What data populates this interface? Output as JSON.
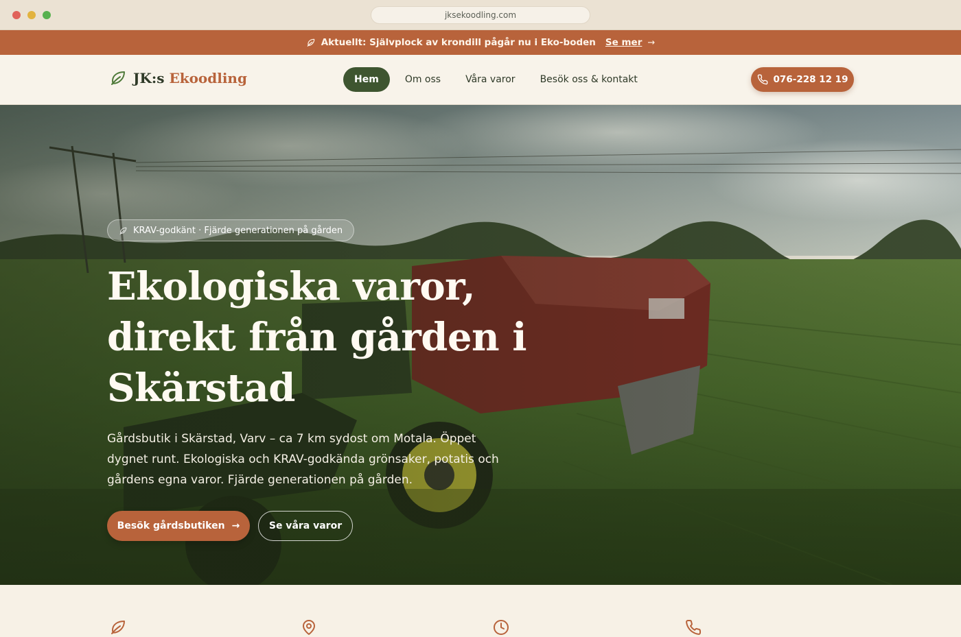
{
  "browser": {
    "url": "jksekoodling.com"
  },
  "announcement": {
    "text": "Aktuellt: Självplock av krondill pågår nu i Eko-boden",
    "link_label": "Se mer",
    "arrow": "→"
  },
  "header": {
    "brand_part1": "JK:s",
    "brand_part2": "Ekoodling",
    "nav": [
      {
        "label": "Hem",
        "active": true
      },
      {
        "label": "Om oss"
      },
      {
        "label": "Våra varor"
      },
      {
        "label": "Besök oss & kontakt"
      }
    ],
    "phone": "076-228 12 19"
  },
  "hero": {
    "badge": "KRAV-godkänt · Fjärde generationen på gården",
    "title": "Ekologiska varor, direkt från gården i Skärstad",
    "lead": "Gårdsbutik i Skärstad, Varv – ca 7 km sydost om Motala. Öppet dygnet runt. Ekologiska och KRAV-godkända grönsaker, potatis och gårdens egna varor. Fjärde generationen på gården.",
    "primary_button": "Besök gårdsbutiken",
    "primary_arrow": "→",
    "secondary_button": "Se våra varor"
  },
  "features": {
    "icons": [
      "leaf-icon",
      "map-pin-icon",
      "clock-icon",
      "phone-icon"
    ]
  },
  "colors": {
    "accent": "#b8633b",
    "nav_active": "#3e5530",
    "background": "#f7f1e6"
  }
}
